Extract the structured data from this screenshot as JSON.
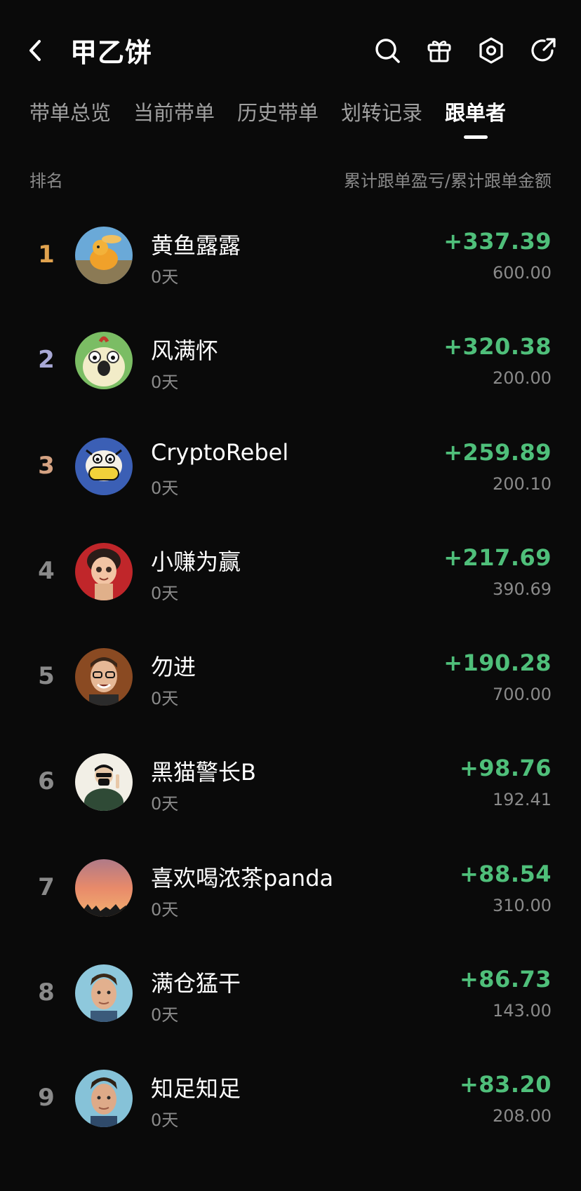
{
  "header": {
    "title": "甲乙饼",
    "icons": [
      "back-chevron-icon",
      "search-icon",
      "gift-icon",
      "settings-hex-icon",
      "share-arrow-icon"
    ]
  },
  "tabs": [
    {
      "label": "带单总览",
      "active": false
    },
    {
      "label": "当前带单",
      "active": false
    },
    {
      "label": "历史带单",
      "active": false
    },
    {
      "label": "划转记录",
      "active": false
    },
    {
      "label": "跟单者",
      "active": true
    }
  ],
  "columns": {
    "left": "排名",
    "right": "累计跟单盈亏/累计跟单金额"
  },
  "colors": {
    "background": "#0a0a0a",
    "profit_green": "#4fbf7a",
    "rank_gold": "#e0a24e",
    "rank_silver": "#a9a9d6",
    "rank_bronze": "#d4a282",
    "muted": "#8a8a8a"
  },
  "followers": [
    {
      "rank": "1",
      "name": "黄鱼露露",
      "days": "0天",
      "pnl": "+337.39",
      "amount": "600.00",
      "avatar": "orange-creature-avatar"
    },
    {
      "rank": "2",
      "name": "风满怀",
      "days": "0天",
      "pnl": "+320.38",
      "amount": "200.00",
      "avatar": "cartoon-bird-avatar"
    },
    {
      "rank": "3",
      "name": "CryptoRebel",
      "days": "0天",
      "pnl": "+259.89",
      "amount": "200.10",
      "avatar": "cartoon-cow-avatar"
    },
    {
      "rank": "4",
      "name": " 小赚为赢",
      "days": "0天",
      "pnl": "+217.69",
      "amount": "390.69",
      "avatar": "cartoon-girl-avatar"
    },
    {
      "rank": "5",
      "name": "勿进",
      "days": "0天",
      "pnl": "+190.28",
      "amount": "700.00",
      "avatar": "man-glasses-avatar"
    },
    {
      "rank": "6",
      "name": "黑猫警长B",
      "days": "0天",
      "pnl": "+98.76",
      "amount": "192.41",
      "avatar": "masked-figure-avatar"
    },
    {
      "rank": "7",
      "name": "喜欢喝浓茶panda",
      "days": "0天",
      "pnl": "+88.54",
      "amount": "310.00",
      "avatar": "sunset-avatar"
    },
    {
      "rank": "8",
      "name": "满仓猛干",
      "days": "0天",
      "pnl": "+86.73",
      "amount": "143.00",
      "avatar": "young-man-avatar"
    },
    {
      "rank": "9",
      "name": "知足知足",
      "days": "0天",
      "pnl": "+83.20",
      "amount": "208.00",
      "avatar": "young-man-avatar-2"
    }
  ]
}
